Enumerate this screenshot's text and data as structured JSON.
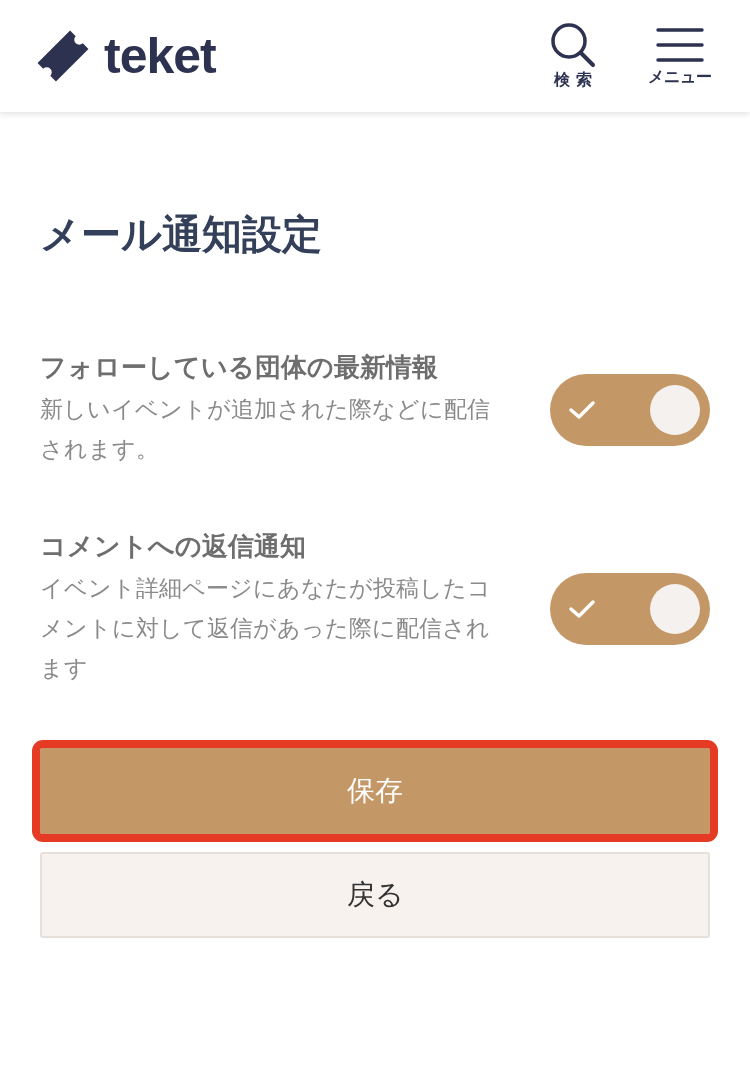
{
  "header": {
    "logo": "teket",
    "search_label": "検 索",
    "menu_label": "メニュー"
  },
  "title": "メール通知設定",
  "settings": [
    {
      "title": "フォローしている団体の最新情報",
      "description": "新しいイベントが追加された際などに配信されます。",
      "on": true
    },
    {
      "title": "コメントへの返信通知",
      "description": "イベント詳細ページにあなたが投稿したコメントに対して返信があった際に配信されます",
      "on": true
    }
  ],
  "buttons": [
    {
      "label": "保存",
      "kind": "primary",
      "highlighted": true
    },
    {
      "label": "戻る",
      "kind": "secondary",
      "highlighted": false
    }
  ]
}
